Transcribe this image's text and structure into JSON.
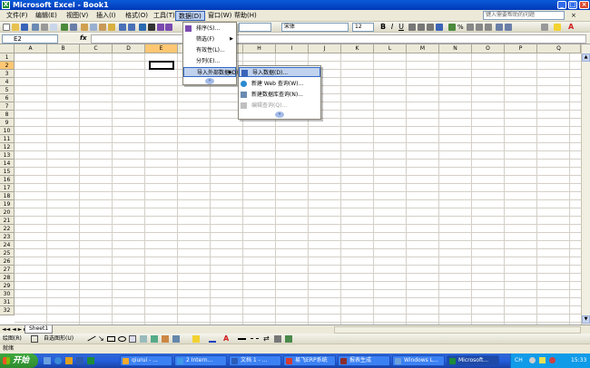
{
  "window": {
    "title": "Microsoft Excel - Book1",
    "icon": "excel-icon"
  },
  "menubar": {
    "items": [
      "文件(F)",
      "编辑(E)",
      "视图(V)",
      "插入(I)",
      "格式(O)",
      "工具(T)",
      "数据(D)",
      "窗口(W)",
      "帮助(H)"
    ],
    "active": "数据(D)",
    "help_placeholder": "键入需要帮助的问题"
  },
  "format_toolbar": {
    "font": "宋体",
    "size": "12"
  },
  "formula_bar": {
    "namebox": "E2",
    "fx_label": "fx",
    "content": ""
  },
  "columns": [
    "A",
    "B",
    "C",
    "D",
    "E",
    "F",
    "G",
    "H",
    "I",
    "J",
    "K",
    "L",
    "M",
    "N",
    "O",
    "P",
    "Q"
  ],
  "rows": [
    "1",
    "2",
    "3",
    "4",
    "5",
    "6",
    "7",
    "8",
    "9",
    "10",
    "11",
    "12",
    "13",
    "14",
    "15",
    "16",
    "17",
    "18",
    "19",
    "20",
    "21",
    "22",
    "23",
    "24",
    "25",
    "26",
    "27",
    "28",
    "29",
    "30",
    "31",
    "32"
  ],
  "active_cell": "E2",
  "data_menu": {
    "items": [
      {
        "label": "排序(S)...",
        "icon": "sort-icon",
        "submenu": false
      },
      {
        "label": "筛选(F)",
        "icon": "",
        "submenu": true
      },
      {
        "label": "有效性(L)...",
        "icon": "",
        "submenu": false
      },
      {
        "label": "分列(E)...",
        "icon": "",
        "submenu": false
      },
      {
        "label": "导入外部数据(D)",
        "icon": "",
        "submenu": true,
        "highlighted": true
      }
    ],
    "expand": "»"
  },
  "import_submenu": {
    "items": [
      {
        "label": "导入数据(D)...",
        "icon": "import-data-icon",
        "highlighted": true,
        "disabled": false
      },
      {
        "label": "新建 Web 查询(W)...",
        "icon": "web-query-icon",
        "highlighted": false,
        "disabled": false
      },
      {
        "label": "新建数据库查询(N)...",
        "icon": "database-query-icon",
        "highlighted": false,
        "disabled": false
      },
      {
        "label": "编辑查询(Q)...",
        "icon": "edit-query-icon",
        "highlighted": false,
        "disabled": true
      }
    ],
    "expand": "»"
  },
  "sheet_tabs": {
    "tabs": [
      "Sheet1"
    ],
    "nav": "◄◄ ◄ ► ►►"
  },
  "drawing_toolbar": {
    "draw_label": "绘图(R)",
    "autoshapes_label": "自选图形(U)"
  },
  "status": {
    "text": "就绪"
  },
  "taskbar": {
    "start_label": "开始",
    "tasks": [
      {
        "label": "qiurui - ...",
        "color": "#f4a92a"
      },
      {
        "label": "2 Intern...",
        "color": "#3f9ae8"
      },
      {
        "label": "文档 1 - ...",
        "color": "#2b5db8"
      },
      {
        "label": "易飞ERP系统",
        "color": "#d63b2f"
      },
      {
        "label": "报表生成",
        "color": "#8c2d2d"
      },
      {
        "label": "Windows L...",
        "color": "#6ca0dc"
      },
      {
        "label": "Microsoft...",
        "color": "#1d8c3a",
        "active": true
      }
    ],
    "tray_lang": "CH",
    "clock": "15:33"
  },
  "colors": {
    "titlebar": "#0a5bd8",
    "menu_highlight": "#c1d2ee",
    "active_header": "#ffc773",
    "taskbar": "#245edb",
    "start": "#3fa93f"
  }
}
